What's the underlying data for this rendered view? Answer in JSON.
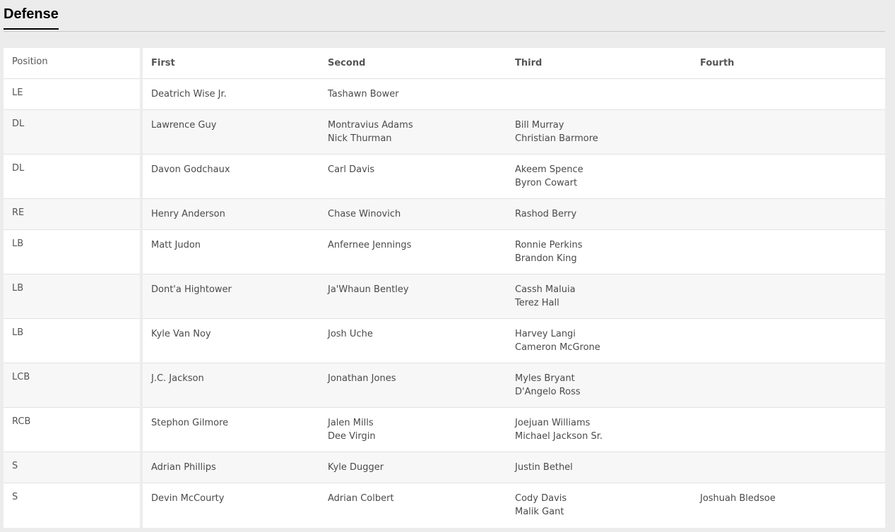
{
  "section": {
    "title": "Defense"
  },
  "columns": {
    "position": "Position",
    "first": "First",
    "second": "Second",
    "third": "Third",
    "fourth": "Fourth"
  },
  "rows": [
    {
      "position": "LE",
      "first": [
        "Deatrich Wise Jr."
      ],
      "second": [
        "Tashawn Bower"
      ],
      "third": [],
      "fourth": []
    },
    {
      "position": "DL",
      "first": [
        "Lawrence Guy"
      ],
      "second": [
        "Montravius Adams",
        "Nick Thurman"
      ],
      "third": [
        "Bill Murray",
        "Christian Barmore"
      ],
      "fourth": []
    },
    {
      "position": "DL",
      "first": [
        "Davon Godchaux"
      ],
      "second": [
        "Carl Davis"
      ],
      "third": [
        "Akeem Spence",
        "Byron Cowart"
      ],
      "fourth": []
    },
    {
      "position": "RE",
      "first": [
        "Henry Anderson"
      ],
      "second": [
        "Chase Winovich"
      ],
      "third": [
        "Rashod Berry"
      ],
      "fourth": []
    },
    {
      "position": "LB",
      "first": [
        "Matt Judon"
      ],
      "second": [
        "Anfernee Jennings"
      ],
      "third": [
        "Ronnie Perkins",
        "Brandon King"
      ],
      "fourth": []
    },
    {
      "position": "LB",
      "first": [
        "Dont'a Hightower"
      ],
      "second": [
        "Ja'Whaun Bentley"
      ],
      "third": [
        "Cassh Maluia",
        "Terez Hall"
      ],
      "fourth": []
    },
    {
      "position": "LB",
      "first": [
        "Kyle Van Noy"
      ],
      "second": [
        "Josh Uche"
      ],
      "third": [
        "Harvey Langi",
        "Cameron McGrone"
      ],
      "fourth": []
    },
    {
      "position": "LCB",
      "first": [
        "J.C. Jackson"
      ],
      "second": [
        "Jonathan Jones"
      ],
      "third": [
        "Myles Bryant",
        "D'Angelo Ross"
      ],
      "fourth": []
    },
    {
      "position": "RCB",
      "first": [
        "Stephon Gilmore"
      ],
      "second": [
        "Jalen Mills",
        "Dee Virgin"
      ],
      "third": [
        "Joejuan Williams",
        "Michael Jackson Sr."
      ],
      "fourth": []
    },
    {
      "position": "S",
      "first": [
        "Adrian Phillips"
      ],
      "second": [
        "Kyle Dugger"
      ],
      "third": [
        "Justin Bethel"
      ],
      "fourth": []
    },
    {
      "position": "S",
      "first": [
        "Devin McCourty"
      ],
      "second": [
        "Adrian Colbert"
      ],
      "third": [
        "Cody Davis",
        "Malik Gant"
      ],
      "fourth": [
        "Joshuah Bledsoe"
      ]
    }
  ]
}
